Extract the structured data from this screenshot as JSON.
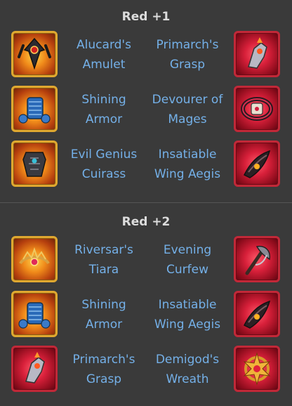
{
  "sections": [
    {
      "heading": "Red +1",
      "rows": [
        {
          "left_item": "Alucard's Amulet",
          "right_item": "Primarch's Grasp",
          "left_icon": "amulet-icon",
          "right_icon": "gauntlet-icon"
        },
        {
          "left_item": "Shining Armor",
          "right_item": "Devourer of Mages",
          "left_icon": "armor-icon",
          "right_icon": "belt-icon"
        },
        {
          "left_item": "Evil Genius Cuirass",
          "right_item": "Insatiable Wing Aegis",
          "left_icon": "cuirass-icon",
          "right_icon": "wing-shield-icon"
        }
      ]
    },
    {
      "heading": "Red +2",
      "rows": [
        {
          "left_item": "Riversar's Tiara",
          "right_item": "Evening Curfew",
          "left_icon": "tiara-icon",
          "right_icon": "axe-icon"
        },
        {
          "left_item": "Shining Armor",
          "right_item": "Insatiable Wing Aegis",
          "left_icon": "armor-icon",
          "right_icon": "wing-shield-icon"
        },
        {
          "left_item": "Primarch's Grasp",
          "right_item": "Demigod's Wreath",
          "left_icon": "gauntlet-icon",
          "right_icon": "wreath-icon"
        }
      ]
    }
  ],
  "colors": {
    "background": "#3a3a3a",
    "heading": "#dcdcdc",
    "item_name": "#74b0e8",
    "gold_frame": "#e0a830",
    "red_frame": "#c22838"
  }
}
